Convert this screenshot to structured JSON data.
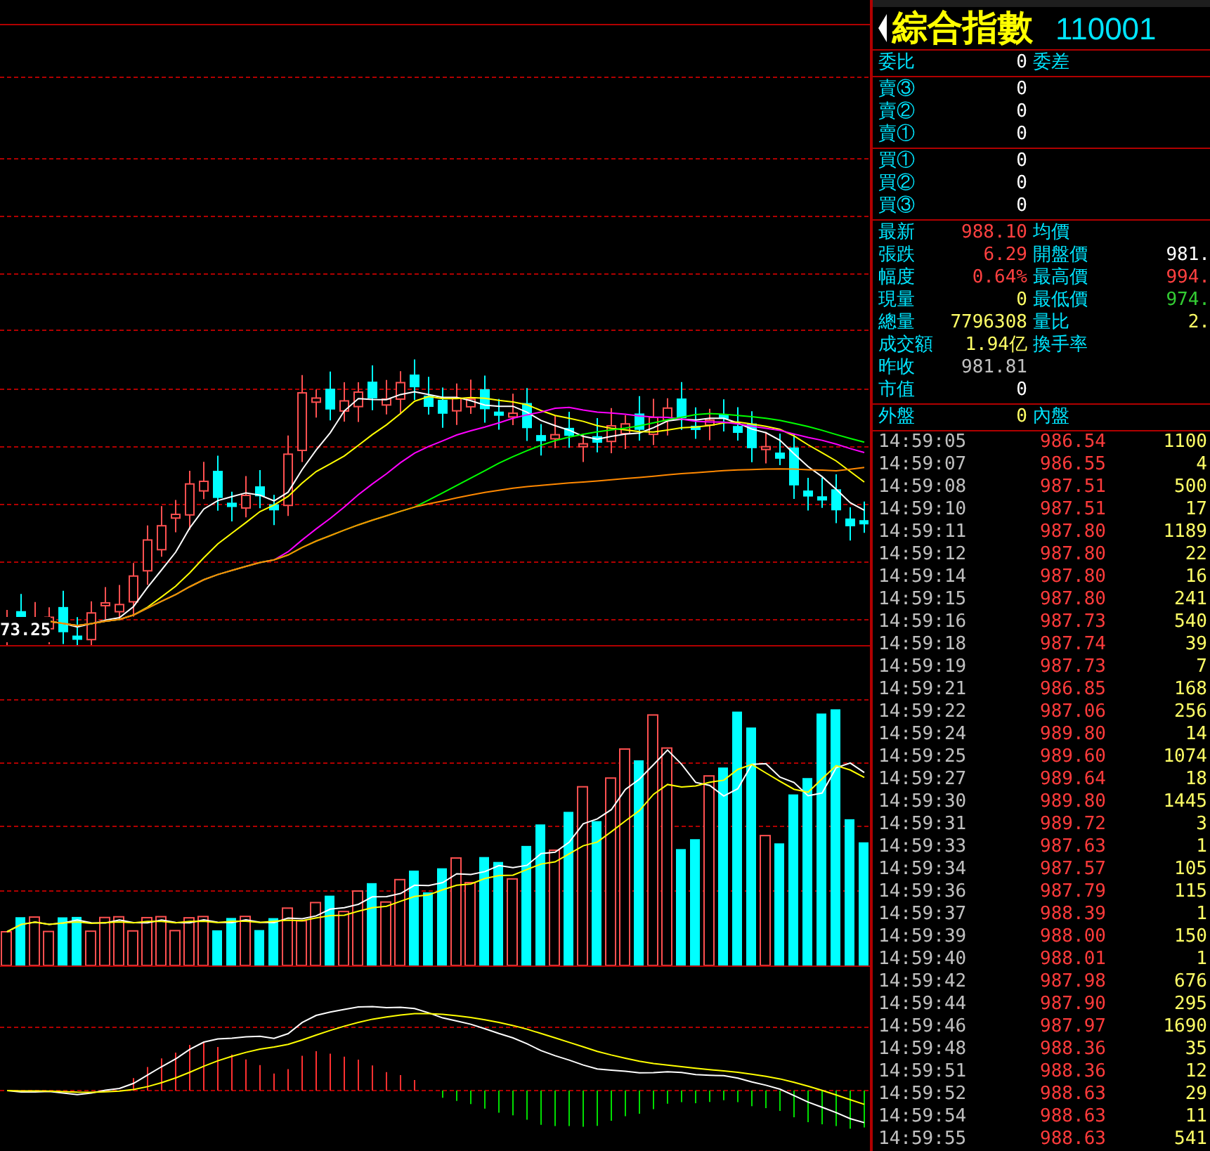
{
  "chart": {
    "low_label": "73.25"
  },
  "quote": {
    "title": "綜合指數",
    "code": "110001",
    "sections": [
      [
        {
          "label": "委比",
          "value": {
            "text": "0",
            "color": "#ffffff"
          },
          "label2": "委差"
        }
      ],
      [
        {
          "label": "賣③",
          "value": {
            "text": "0",
            "color": "#ffffff"
          }
        },
        {
          "label": "賣②",
          "value": {
            "text": "0",
            "color": "#ffffff"
          }
        },
        {
          "label": "賣①",
          "value": {
            "text": "0",
            "color": "#ffffff"
          }
        }
      ],
      [
        {
          "label": "買①",
          "value": {
            "text": "0",
            "color": "#ffffff"
          }
        },
        {
          "label": "買②",
          "value": {
            "text": "0",
            "color": "#ffffff"
          }
        },
        {
          "label": "買③",
          "value": {
            "text": "0",
            "color": "#ffffff"
          }
        }
      ],
      [
        {
          "label": "最新",
          "value": {
            "text": "988.10",
            "color": "#ff4040"
          },
          "label2": "均價"
        },
        {
          "label": "張跌",
          "value": {
            "text": "6.29",
            "color": "#ff4040"
          },
          "label2": "開盤價",
          "value2": {
            "text": "981.",
            "color": "#ffffff"
          }
        },
        {
          "label": "幅度",
          "value": {
            "text": "0.64%",
            "color": "#ff4040"
          },
          "label2": "最高價",
          "value2": {
            "text": "994.",
            "color": "#ff4040"
          }
        },
        {
          "label": "現量",
          "value": {
            "text": "0",
            "color": "#ffff66"
          },
          "label2": "最低價",
          "value2": {
            "text": "974.",
            "color": "#33cc33"
          }
        },
        {
          "label": "總量",
          "value": {
            "text": "7796308",
            "color": "#ffff66"
          },
          "label2": "量比",
          "value2": {
            "text": "2.",
            "color": "#ffff66"
          }
        },
        {
          "label": "成交額",
          "value": {
            "text": "1.94亿",
            "color": "#ffff66"
          },
          "label2": "換手率"
        },
        {
          "label": "昨收",
          "value": {
            "text": "981.81",
            "color": "#c0c0c0"
          }
        },
        {
          "label": "市值",
          "value": {
            "text": "0",
            "color": "#ffffff"
          }
        }
      ],
      [
        {
          "label": "外盤",
          "value": {
            "text": "0",
            "color": "#ffff66"
          },
          "label2": "內盤"
        }
      ]
    ],
    "ticks": [
      {
        "time": "14:59:05",
        "price": "986.54",
        "volume": "1100"
      },
      {
        "time": "14:59:07",
        "price": "986.55",
        "volume": "4"
      },
      {
        "time": "14:59:08",
        "price": "987.51",
        "volume": "500"
      },
      {
        "time": "14:59:10",
        "price": "987.51",
        "volume": "17"
      },
      {
        "time": "14:59:11",
        "price": "987.80",
        "volume": "1189"
      },
      {
        "time": "14:59:12",
        "price": "987.80",
        "volume": "22"
      },
      {
        "time": "14:59:14",
        "price": "987.80",
        "volume": "16"
      },
      {
        "time": "14:59:15",
        "price": "987.80",
        "volume": "241"
      },
      {
        "time": "14:59:16",
        "price": "987.73",
        "volume": "540"
      },
      {
        "time": "14:59:18",
        "price": "987.74",
        "volume": "39"
      },
      {
        "time": "14:59:19",
        "price": "987.73",
        "volume": "7"
      },
      {
        "time": "14:59:21",
        "price": "986.85",
        "volume": "168"
      },
      {
        "time": "14:59:22",
        "price": "987.06",
        "volume": "256"
      },
      {
        "time": "14:59:24",
        "price": "989.80",
        "volume": "14"
      },
      {
        "time": "14:59:25",
        "price": "989.60",
        "volume": "1074"
      },
      {
        "time": "14:59:27",
        "price": "989.64",
        "volume": "18"
      },
      {
        "time": "14:59:30",
        "price": "989.80",
        "volume": "1445"
      },
      {
        "time": "14:59:31",
        "price": "989.72",
        "volume": "3"
      },
      {
        "time": "14:59:33",
        "price": "987.63",
        "volume": "1"
      },
      {
        "time": "14:59:34",
        "price": "987.57",
        "volume": "105"
      },
      {
        "time": "14:59:36",
        "price": "987.79",
        "volume": "115"
      },
      {
        "time": "14:59:37",
        "price": "988.39",
        "volume": "1"
      },
      {
        "time": "14:59:39",
        "price": "988.00",
        "volume": "150"
      },
      {
        "time": "14:59:40",
        "price": "988.01",
        "volume": "1"
      },
      {
        "time": "14:59:42",
        "price": "987.98",
        "volume": "676"
      },
      {
        "time": "14:59:44",
        "price": "987.90",
        "volume": "295"
      },
      {
        "time": "14:59:46",
        "price": "987.97",
        "volume": "1690"
      },
      {
        "time": "14:59:48",
        "price": "988.36",
        "volume": "35"
      },
      {
        "time": "14:59:51",
        "price": "988.36",
        "volume": "12"
      },
      {
        "time": "14:59:52",
        "price": "988.63",
        "volume": "29"
      },
      {
        "time": "14:59:54",
        "price": "988.63",
        "volume": "11"
      },
      {
        "time": "14:59:55",
        "price": "988.63",
        "volume": "541"
      }
    ]
  }
}
